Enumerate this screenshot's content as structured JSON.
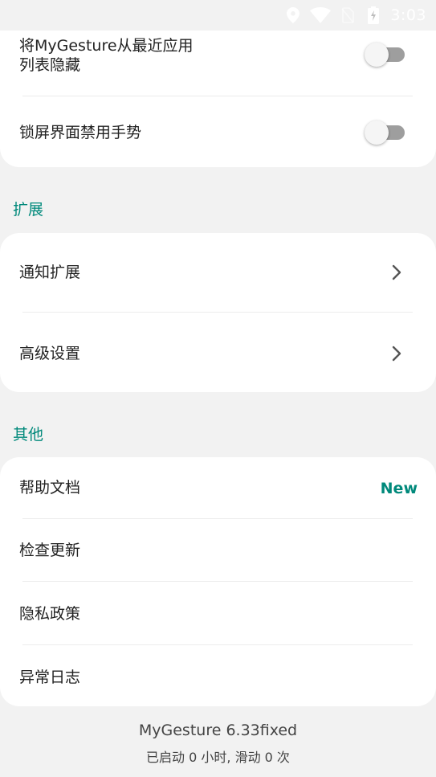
{
  "status_bar": {
    "time": "3:03",
    "icons": [
      "location-icon",
      "wifi-icon",
      "no-sim-icon",
      "battery-charging-icon"
    ]
  },
  "card1": {
    "rows": [
      {
        "label_line1": "将MyGesture从最近应用",
        "label_line2": "列表隐藏",
        "toggle_on": false
      },
      {
        "label": "锁屏界面禁用手势",
        "toggle_on": false
      }
    ]
  },
  "section_extend": {
    "title": "扩展",
    "items": [
      {
        "label": "通知扩展",
        "icon": "chevron-right-icon"
      },
      {
        "label": "高级设置",
        "icon": "chevron-right-icon"
      }
    ]
  },
  "section_other": {
    "title": "其他",
    "items": [
      {
        "label": "帮助文档",
        "badge": "New"
      },
      {
        "label": "检查更新"
      },
      {
        "label": "隐私政策"
      },
      {
        "label": "异常日志"
      }
    ]
  },
  "footer": {
    "version": "MyGesture 6.33fixed",
    "stats": "已启动 0 小时, 滑动 0 次"
  },
  "colors": {
    "accent": "#00897b",
    "background": "#f2f2f2",
    "card": "#ffffff",
    "toggle_track_off": "#9e9e9e"
  }
}
